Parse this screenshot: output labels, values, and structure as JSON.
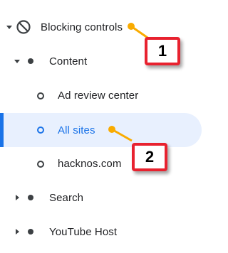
{
  "tree": {
    "blocking_controls": {
      "label": "Blocking controls",
      "icon": "block-icon"
    },
    "content": {
      "label": "Content"
    },
    "ad_review_center": {
      "label": "Ad review center"
    },
    "all_sites": {
      "label": "All sites",
      "selected": true
    },
    "hacknos": {
      "label": "hacknos.com"
    },
    "search": {
      "label": "Search"
    },
    "youtube_host": {
      "label": "YouTube Host"
    }
  },
  "annotations": {
    "callout_1": "1",
    "callout_2": "2"
  },
  "colors": {
    "accent": "#1a73e8",
    "selected_bg": "#e8f0fe",
    "callout_border": "#e8222f",
    "pin": "#f9ab00"
  }
}
